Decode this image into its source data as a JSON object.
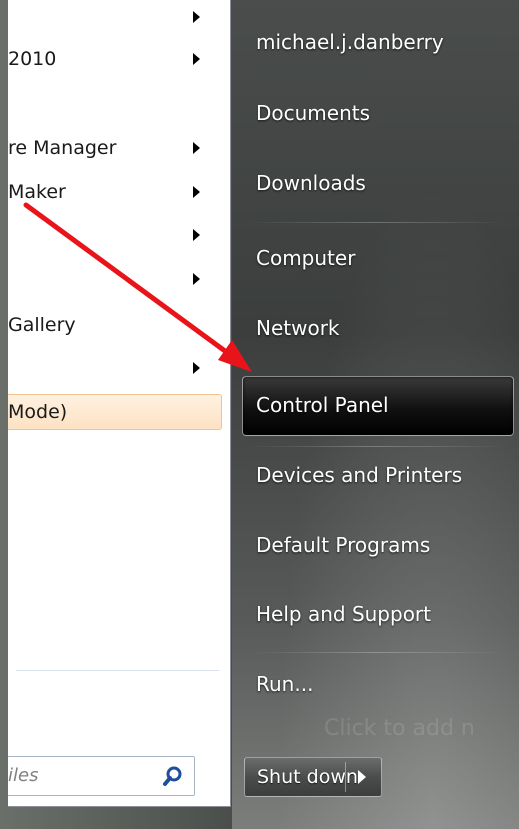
{
  "programs": [
    {
      "label": "",
      "submenu": true
    },
    {
      "label": " 2010",
      "submenu": true
    },
    {
      "label": "re Manager",
      "submenu": true
    },
    {
      "label": "Maker",
      "submenu": true
    },
    {
      "label": "",
      "submenu": true
    },
    {
      "label": "",
      "submenu": true
    },
    {
      "label": "Gallery",
      "submenu": false
    },
    {
      "label": "",
      "submenu": true
    },
    {
      "label": "Mode)",
      "submenu": false,
      "highlight": true
    }
  ],
  "search": {
    "placeholder": "iles"
  },
  "right_menu": {
    "user": "michael.j.danberry",
    "documents": "Documents",
    "downloads": "Downloads",
    "computer": "Computer",
    "network": "Network",
    "control_panel": "Control Panel",
    "devices": "Devices and Printers",
    "defaults": "Default Programs",
    "help": "Help and Support",
    "run": "Run..."
  },
  "background_hint": "Click to add n",
  "shutdown": {
    "label": "Shut down"
  },
  "colors": {
    "annotation_arrow": "#e8141a",
    "highlight": "#fde2c3"
  }
}
